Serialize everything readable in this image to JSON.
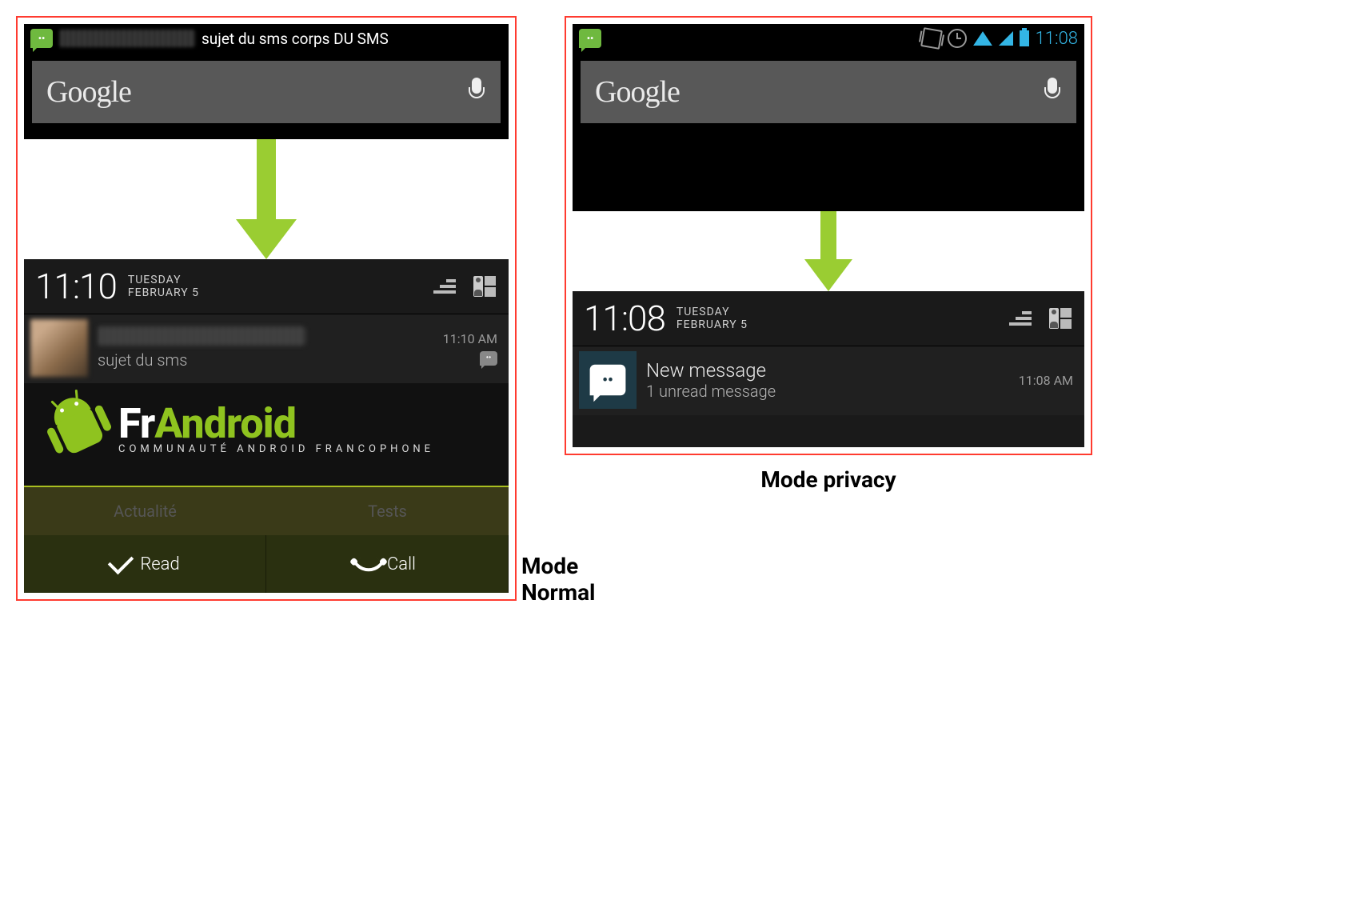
{
  "left": {
    "status_notification": "sujet du sms corps DU SMS",
    "search_placeholder": "Google",
    "shade": {
      "time": "11:10",
      "day": "TUESDAY",
      "date": "FEBRUARY 5"
    },
    "notif": {
      "subject": "sujet du sms",
      "time": "11:10 AM"
    },
    "frandroid": {
      "fr": "Fr",
      "android": "Android",
      "tagline": "COMMUNAUTÉ ANDROID FRANCOPHONE",
      "tab1": "Actualité",
      "tab2": "Tests"
    },
    "actions": {
      "read": "Read",
      "call": "Call"
    },
    "caption": "Mode Normal"
  },
  "right": {
    "clock": "11:08",
    "search_placeholder": "Google",
    "shade": {
      "time": "11:08",
      "day": "TUESDAY",
      "date": "FEBRUARY 5"
    },
    "notif": {
      "title": "New message",
      "sub": "1 unread message",
      "time": "11:08 AM"
    },
    "caption": "Mode privacy"
  }
}
